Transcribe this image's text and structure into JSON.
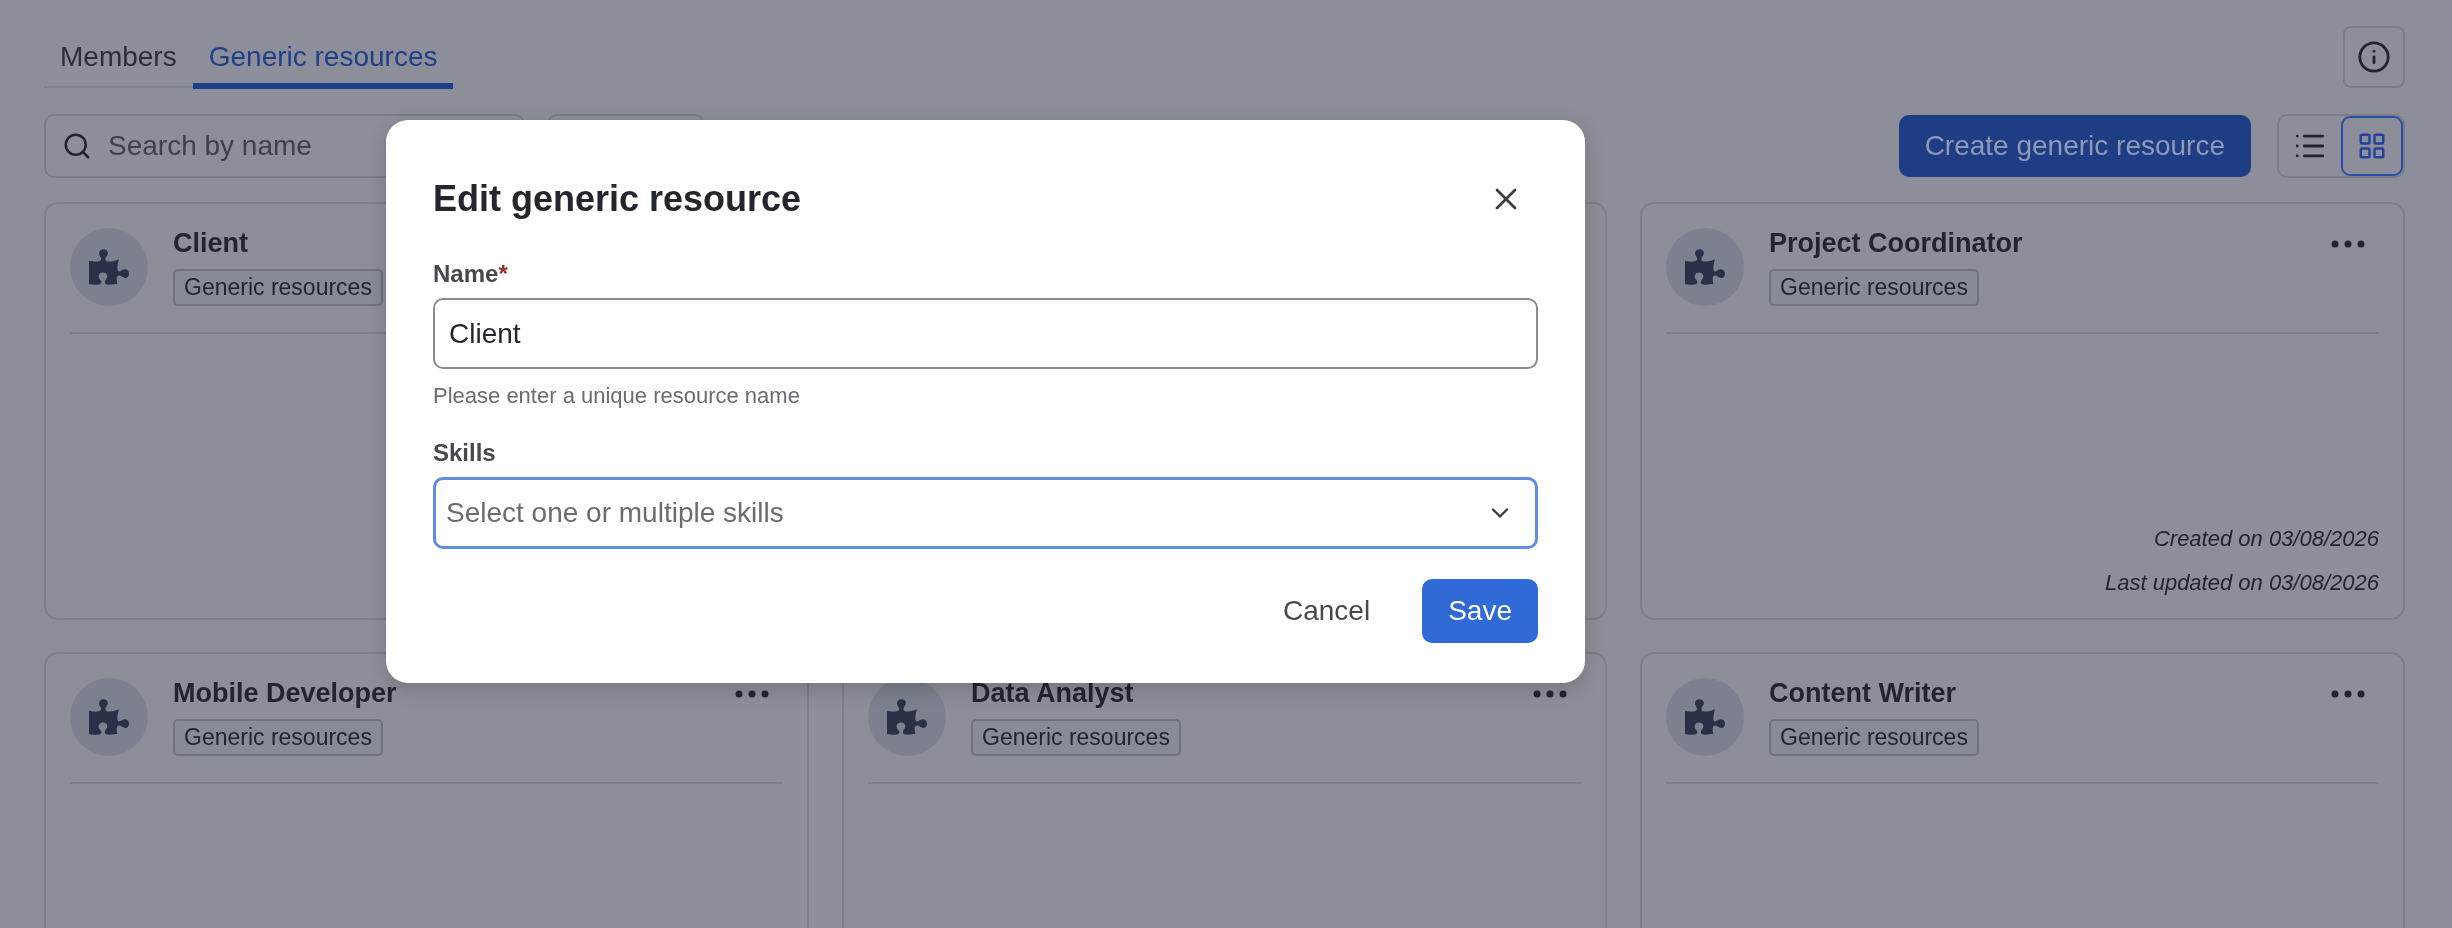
{
  "tabs": [
    {
      "label": "Members",
      "selected": false
    },
    {
      "label": "Generic resources",
      "selected": true
    }
  ],
  "search": {
    "placeholder": "Search by name"
  },
  "create_button": "Create generic resource",
  "view_toggle": [
    {
      "kind": "list",
      "selected": false
    },
    {
      "kind": "grid",
      "selected": true
    }
  ],
  "cards": [
    {
      "title": "Client",
      "tag": "Generic resources",
      "menu": false
    },
    {
      "menu": false
    },
    {
      "title": "Project Coordinator",
      "tag": "Generic resources",
      "menu": true,
      "created": "Created on 03/08/2026",
      "updated": "Last updated on 03/08/2026"
    },
    {
      "title": "Mobile Developer",
      "tag": "Generic resources",
      "menu": true
    },
    {
      "title": "Data Analyst",
      "tag": "Generic resources",
      "menu": true
    },
    {
      "title": "Content Writer",
      "tag": "Generic resources",
      "menu": true
    }
  ],
  "dialog": {
    "title": "Edit generic resource",
    "name_field": {
      "label": "Name",
      "required_mark": "*",
      "value": "Client",
      "hint": "Please enter a unique resource name"
    },
    "skills_field": {
      "label": "Skills",
      "placeholder": "Select one or multiple skills",
      "focused": true
    },
    "buttons": [
      {
        "kind": "secondary",
        "label": "Cancel"
      },
      {
        "kind": "primary",
        "label": "Save"
      }
    ]
  }
}
